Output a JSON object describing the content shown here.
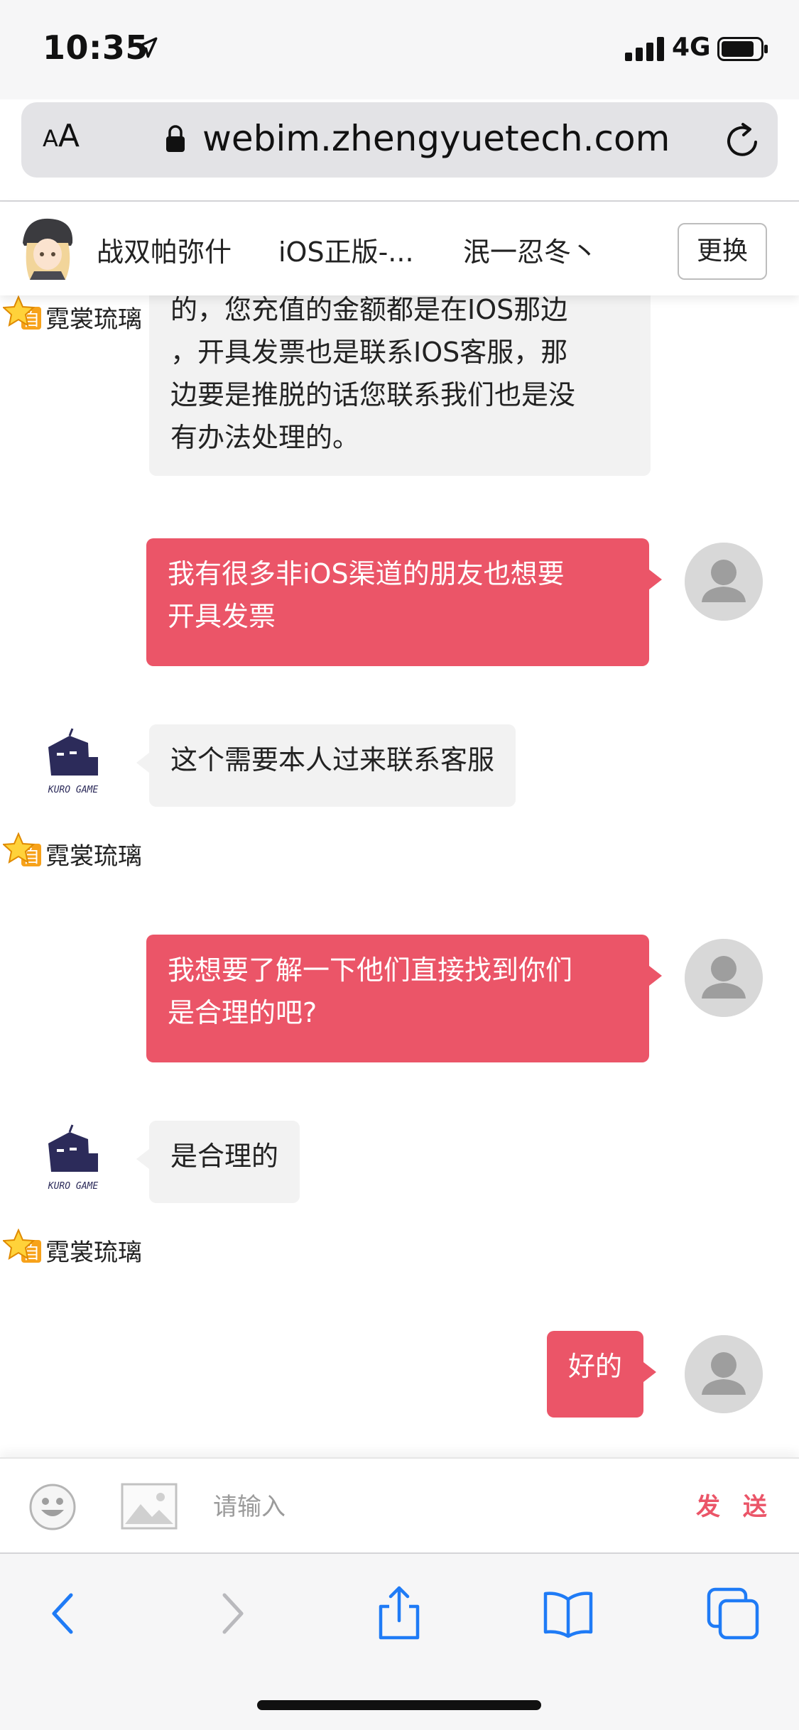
{
  "status_bar": {
    "time": "10:35",
    "network": "4G"
  },
  "browser": {
    "aa_label_small": "A",
    "aa_label_large": "A",
    "url": "webim.zhengyuetech.com"
  },
  "header": {
    "tabs": [
      {
        "label": "战双帕弥什"
      },
      {
        "label": "iOS正版-..."
      },
      {
        "label": "泯一忍冬丶"
      }
    ],
    "switch_label": "更换"
  },
  "agent_name": "霓裳琉璃",
  "messages": [
    {
      "from": "agent",
      "lines": [
        "的，您充值的金额都是在IOS那边",
        "，开具发票也是联系IOS客服，那",
        "边要是推脱的话您联系我们也是没",
        "有办法处理的。"
      ]
    },
    {
      "from": "user",
      "lines": [
        "我有很多非iOS渠道的朋友也想要",
        "开具发票"
      ]
    },
    {
      "from": "agent",
      "lines": [
        "这个需要本人过来联系客服"
      ]
    },
    {
      "from": "user",
      "lines": [
        "我想要了解一下他们直接找到你们",
        "是合理的吧?"
      ]
    },
    {
      "from": "agent",
      "lines": [
        "是合理的"
      ]
    },
    {
      "from": "user",
      "lines": [
        "好的"
      ]
    }
  ],
  "input": {
    "placeholder": "请输入",
    "send_label": "发 送"
  },
  "colors": {
    "outgoing_bubble": "#eb5568",
    "incoming_bubble": "#f2f2f2",
    "send_text": "#eb5568",
    "ios_blue": "#1f7bf6"
  }
}
